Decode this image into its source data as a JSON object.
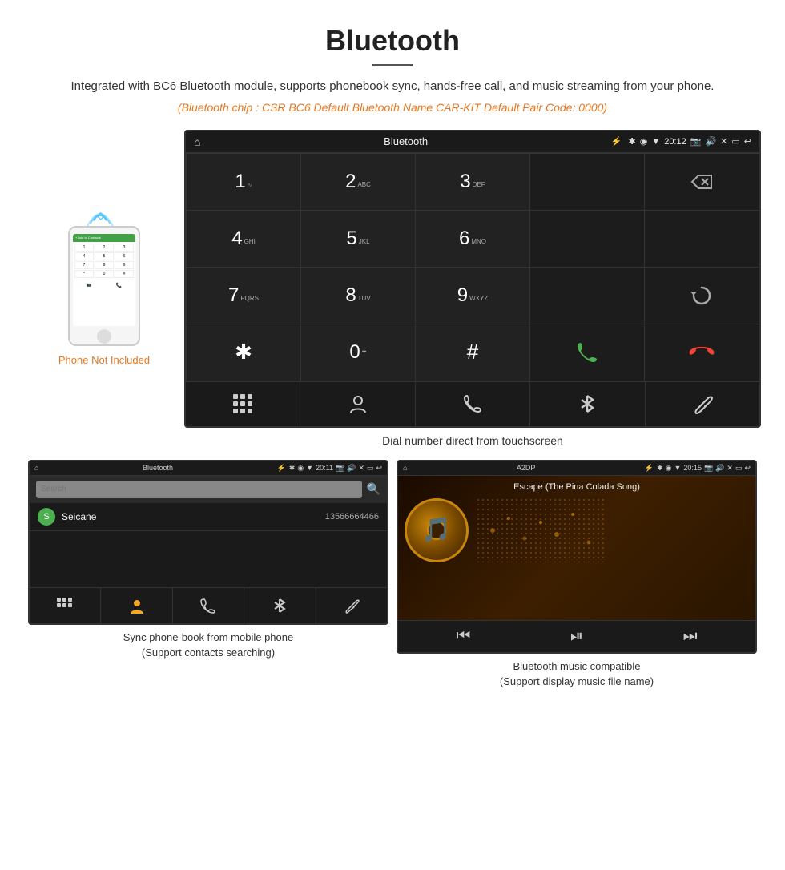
{
  "header": {
    "title": "Bluetooth",
    "description": "Integrated with BC6 Bluetooth module, supports phonebook sync, hands-free call, and music streaming from your phone.",
    "specs": "(Bluetooth chip : CSR BC6    Default Bluetooth Name CAR-KIT    Default Pair Code: 0000)"
  },
  "phone_aside": {
    "not_included": "Phone Not Included"
  },
  "car_screen": {
    "statusbar": {
      "title": "Bluetooth",
      "time": "20:12"
    },
    "dialpad": {
      "keys": [
        {
          "main": "1",
          "sub": ""
        },
        {
          "main": "2",
          "sub": "ABC"
        },
        {
          "main": "3",
          "sub": "DEF"
        },
        {
          "main": "",
          "sub": ""
        },
        {
          "main": "⌫",
          "sub": ""
        },
        {
          "main": "4",
          "sub": "GHI"
        },
        {
          "main": "5",
          "sub": "JKL"
        },
        {
          "main": "6",
          "sub": "MNO"
        },
        {
          "main": "",
          "sub": ""
        },
        {
          "main": "",
          "sub": ""
        },
        {
          "main": "7",
          "sub": "PQRS"
        },
        {
          "main": "8",
          "sub": "TUV"
        },
        {
          "main": "9",
          "sub": "WXYZ"
        },
        {
          "main": "",
          "sub": ""
        },
        {
          "main": "↻",
          "sub": ""
        },
        {
          "main": "✱",
          "sub": ""
        },
        {
          "main": "0",
          "sub": "+"
        },
        {
          "main": "#",
          "sub": ""
        },
        {
          "main": "📞",
          "sub": ""
        },
        {
          "main": "📵",
          "sub": ""
        }
      ],
      "bottom_icons": [
        "⠿",
        "👤",
        "📞",
        "✱",
        "🔗"
      ]
    }
  },
  "main_caption": "Dial number direct from touchscreen",
  "bottom_left": {
    "statusbar_title": "Bluetooth",
    "statusbar_time": "20:11",
    "search_placeholder": "Search",
    "contact": {
      "letter": "S",
      "name": "Seicane",
      "number": "13566664466"
    },
    "caption1": "Sync phone-book from mobile phone",
    "caption2": "(Support contacts searching)"
  },
  "bottom_right": {
    "statusbar_title": "A2DP",
    "statusbar_time": "20:15",
    "song_title": "Escape (The Pina Colada Song)",
    "caption1": "Bluetooth music compatible",
    "caption2": "(Support display music file name)"
  }
}
